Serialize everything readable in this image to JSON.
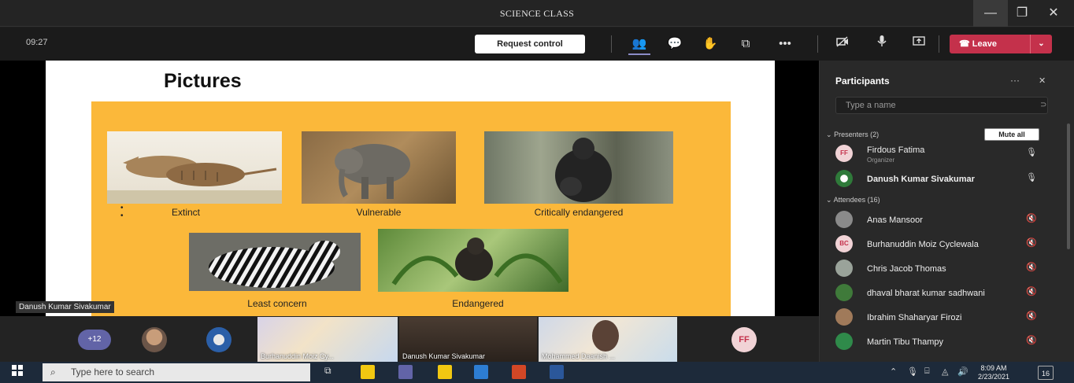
{
  "window": {
    "title": "SCIENCE CLASS",
    "minimize": "—",
    "maximize": "❐",
    "close": "✕"
  },
  "toolbar": {
    "timer": "09:27",
    "request_control": "Request control",
    "leave": "Leave",
    "leave_caret": "⌄"
  },
  "slide": {
    "title": "Pictures",
    "captions": [
      "Extinct",
      "Vulnerable",
      "Critically endangered",
      "Least concern",
      "Endangered"
    ],
    "bullets": [
      "•",
      "•"
    ]
  },
  "presenter_tag": "Danush Kumar Sivakumar",
  "strip": {
    "overflow": "+12",
    "tiles": [
      "Burhanuddin Moiz Cy...",
      "Danush Kumar Sivakumar",
      "Mohammed Daanish ..."
    ],
    "initials": "FF"
  },
  "participants": {
    "title": "Participants",
    "more": "···",
    "close": "✕",
    "search_placeholder": "Type a name",
    "presenters_label": "Presenters (2)",
    "mute_all": "Mute all",
    "attendees_label": "Attendees (16)",
    "presenters": [
      {
        "initials": "FF",
        "name": "Firdous Fatima",
        "role": "Organizer"
      },
      {
        "initials": "",
        "name": "Danush Kumar Sivakumar",
        "role": ""
      }
    ],
    "attendees": [
      {
        "initials": "",
        "name": "Anas Mansoor"
      },
      {
        "initials": "BC",
        "name": "Burhanuddin Moiz Cyclewala"
      },
      {
        "initials": "",
        "name": "Chris Jacob Thomas"
      },
      {
        "initials": "",
        "name": "dhaval bharat kumar sadhwani"
      },
      {
        "initials": "",
        "name": "Ibrahim Shaharyar Firozi"
      },
      {
        "initials": "",
        "name": "Martin Tibu Thampy"
      }
    ]
  },
  "taskbar": {
    "search_placeholder": "Type here to search",
    "time": "8:09 AM",
    "date": "2/23/2021",
    "notifications": "16"
  },
  "colors": {
    "accent_leave": "#c4314b",
    "slide_panel": "#fbb83a"
  }
}
